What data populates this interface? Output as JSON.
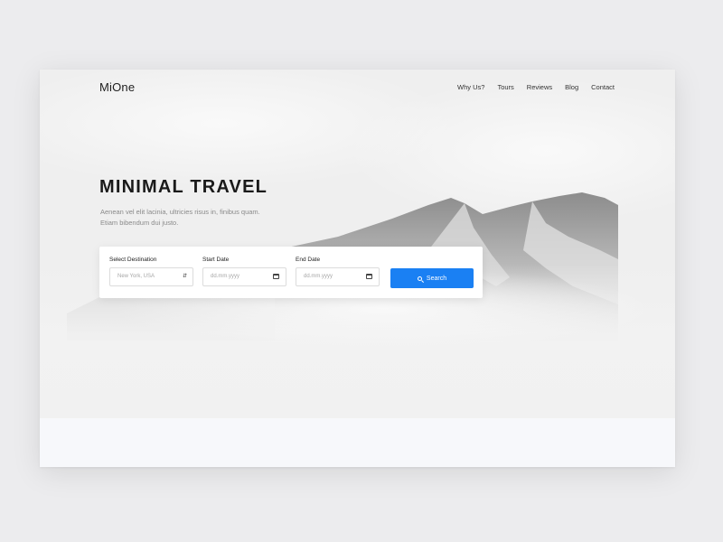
{
  "brand": {
    "name": "MiOne"
  },
  "nav": {
    "items": [
      {
        "label": "Why Us?"
      },
      {
        "label": "Tours"
      },
      {
        "label": "Reviews"
      },
      {
        "label": "Blog"
      },
      {
        "label": "Contact"
      }
    ]
  },
  "hero": {
    "title": "MINIMAL TRAVEL",
    "subtitle": "Aenean vel elit lacinia, ultricies risus in, finibus quam. Etiam bibendum dui justo."
  },
  "search": {
    "destination_label": "Select Destination",
    "destination_value": "New York, USA",
    "start_label": "Start Date",
    "start_placeholder": "dd.mm.yyyy",
    "end_label": "End Date",
    "end_placeholder": "dd.mm.yyyy",
    "button_label": "Search"
  },
  "colors": {
    "accent": "#1a80f3",
    "page_bg": "#ececee",
    "text_dark": "#1a1a1a",
    "text_muted": "#8a8a8a"
  },
  "icons": {
    "select_caret": "chevron-up-down-icon",
    "date_picker": "calendar-icon",
    "search": "search-icon"
  }
}
